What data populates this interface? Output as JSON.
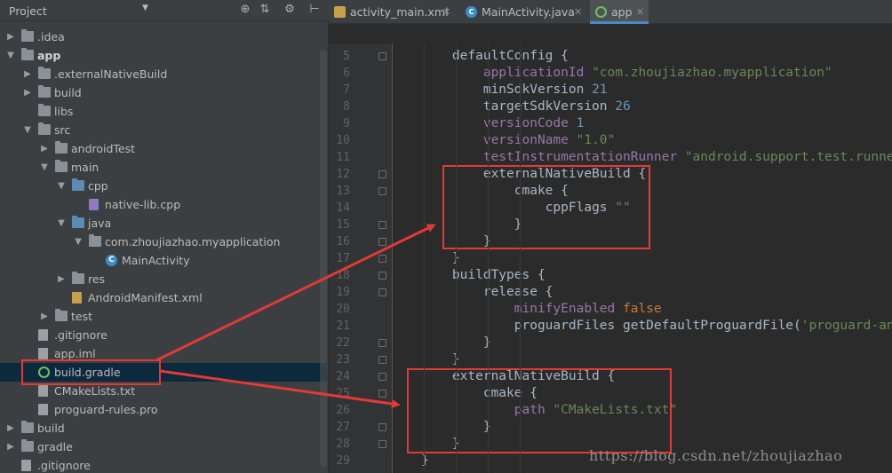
{
  "project_panel": {
    "title": "Project",
    "toolbar_icons": [
      "sync-icon",
      "collapse-icon",
      "gear-icon",
      "hide-icon"
    ],
    "tree": [
      {
        "label": ".idea",
        "depth": 0,
        "arrow": "right",
        "icon": "folder",
        "bold": false
      },
      {
        "label": "app",
        "depth": 0,
        "arrow": "down",
        "icon": "module",
        "bold": true
      },
      {
        "label": ".externalNativeBuild",
        "depth": 1,
        "arrow": "right",
        "icon": "folder",
        "bold": false
      },
      {
        "label": "build",
        "depth": 1,
        "arrow": "right",
        "icon": "folder",
        "bold": false
      },
      {
        "label": "libs",
        "depth": 1,
        "arrow": "",
        "icon": "folder",
        "bold": false
      },
      {
        "label": "src",
        "depth": 1,
        "arrow": "down",
        "icon": "folder",
        "bold": false
      },
      {
        "label": "androidTest",
        "depth": 2,
        "arrow": "right",
        "icon": "folder",
        "bold": false
      },
      {
        "label": "main",
        "depth": 2,
        "arrow": "down",
        "icon": "folder",
        "bold": false
      },
      {
        "label": "cpp",
        "depth": 3,
        "arrow": "down",
        "icon": "folder-blue",
        "bold": false
      },
      {
        "label": "native-lib.cpp",
        "depth": 4,
        "arrow": "",
        "icon": "cpp-file",
        "bold": false
      },
      {
        "label": "java",
        "depth": 3,
        "arrow": "down",
        "icon": "folder-blue",
        "bold": false
      },
      {
        "label": "com.zhoujiazhao.myapplication",
        "depth": 4,
        "arrow": "down",
        "icon": "package",
        "bold": false
      },
      {
        "label": "MainActivity",
        "depth": 5,
        "arrow": "",
        "icon": "class",
        "bold": false
      },
      {
        "label": "res",
        "depth": 3,
        "arrow": "right",
        "icon": "folder-res",
        "bold": false
      },
      {
        "label": "AndroidManifest.xml",
        "depth": 3,
        "arrow": "",
        "icon": "xml-file",
        "bold": false
      },
      {
        "label": "test",
        "depth": 2,
        "arrow": "right",
        "icon": "folder",
        "bold": false
      },
      {
        "label": ".gitignore",
        "depth": 1,
        "arrow": "",
        "icon": "file",
        "bold": false
      },
      {
        "label": "app.iml",
        "depth": 1,
        "arrow": "",
        "icon": "file",
        "bold": false
      },
      {
        "label": "build.gradle",
        "depth": 1,
        "arrow": "",
        "icon": "gradle",
        "bold": false,
        "selected": true
      },
      {
        "label": "CMakeLists.txt",
        "depth": 1,
        "arrow": "",
        "icon": "file",
        "bold": false
      },
      {
        "label": "proguard-rules.pro",
        "depth": 1,
        "arrow": "",
        "icon": "file",
        "bold": false
      },
      {
        "label": "build",
        "depth": 0,
        "arrow": "right",
        "icon": "folder",
        "bold": false
      },
      {
        "label": "gradle",
        "depth": 0,
        "arrow": "right",
        "icon": "folder",
        "bold": false
      },
      {
        "label": ".gitignore",
        "depth": 0,
        "arrow": "",
        "icon": "file",
        "bold": false
      }
    ]
  },
  "tabs": [
    {
      "label": "activity_main.xml",
      "icon": "xml-file-icon",
      "active": false
    },
    {
      "label": "MainActivity.java",
      "icon": "class-icon",
      "active": false
    },
    {
      "label": "app",
      "icon": "gradle-icon",
      "active": true
    }
  ],
  "code": {
    "first_line_number": 5,
    "lines": [
      [
        [
          "    ",
          "k"
        ],
        [
          "defaultConfig {",
          "k"
        ]
      ],
      [
        [
          "        ",
          "k"
        ],
        [
          "applicationId ",
          "p"
        ],
        [
          "\"com.zhoujiazhao.myapplication\"",
          "s"
        ]
      ],
      [
        [
          "        ",
          "k"
        ],
        [
          "minSdkVersion ",
          "k"
        ],
        [
          "21",
          "n"
        ]
      ],
      [
        [
          "        ",
          "k"
        ],
        [
          "targetSdkVersion ",
          "k"
        ],
        [
          "26",
          "n"
        ]
      ],
      [
        [
          "        ",
          "k"
        ],
        [
          "versionCode ",
          "p"
        ],
        [
          "1",
          "n"
        ]
      ],
      [
        [
          "        ",
          "k"
        ],
        [
          "versionName ",
          "p"
        ],
        [
          "\"1.0\"",
          "s"
        ]
      ],
      [
        [
          "        ",
          "k"
        ],
        [
          "testInstrumentationRunner ",
          "p"
        ],
        [
          "\"android.support.test.runner.",
          "s"
        ]
      ],
      [
        [
          "        ",
          "k"
        ],
        [
          "externalNativeBuild {",
          "k"
        ]
      ],
      [
        [
          "            ",
          "k"
        ],
        [
          "cmake {",
          "k"
        ]
      ],
      [
        [
          "                ",
          "k"
        ],
        [
          "cppFlags ",
          "k"
        ],
        [
          "\"\"",
          "s"
        ]
      ],
      [
        [
          "            ",
          "k"
        ],
        [
          "}",
          "k"
        ]
      ],
      [
        [
          "        ",
          "k"
        ],
        [
          "}",
          "k"
        ]
      ],
      [
        [
          "    ",
          "k"
        ],
        [
          "}",
          "k"
        ]
      ],
      [
        [
          "    ",
          "k"
        ],
        [
          "buildTypes {",
          "k"
        ]
      ],
      [
        [
          "        ",
          "k"
        ],
        [
          "release {",
          "k"
        ]
      ],
      [
        [
          "            ",
          "k"
        ],
        [
          "minifyEnabled ",
          "p"
        ],
        [
          "false",
          "kw"
        ]
      ],
      [
        [
          "            ",
          "k"
        ],
        [
          "proguardFiles getDefaultProguardFile(",
          "k"
        ],
        [
          "'proguard-andr",
          "s"
        ]
      ],
      [
        [
          "        ",
          "k"
        ],
        [
          "}",
          "k"
        ]
      ],
      [
        [
          "    ",
          "k"
        ],
        [
          "}",
          "k"
        ]
      ],
      [
        [
          "    ",
          "k"
        ],
        [
          "externalNativeBuild {",
          "k"
        ]
      ],
      [
        [
          "        ",
          "k"
        ],
        [
          "cmake {",
          "k"
        ]
      ],
      [
        [
          "            ",
          "k"
        ],
        [
          "path ",
          "p"
        ],
        [
          "\"CMakeLists.txt\"",
          "s"
        ]
      ],
      [
        [
          "        ",
          "k"
        ],
        [
          "}",
          "k"
        ]
      ],
      [
        [
          "    ",
          "k"
        ],
        [
          "}",
          "k"
        ]
      ],
      [
        [
          "",
          "k"
        ],
        [
          "}",
          "k"
        ]
      ]
    ]
  },
  "watermark": "https://blog.csdn.net/zhoujiazhao",
  "colors": {
    "panel_bg": "#3c3f41",
    "editor_bg": "#2b2b2b",
    "annotation_red": "#e53935",
    "selection": "#0d293e"
  }
}
